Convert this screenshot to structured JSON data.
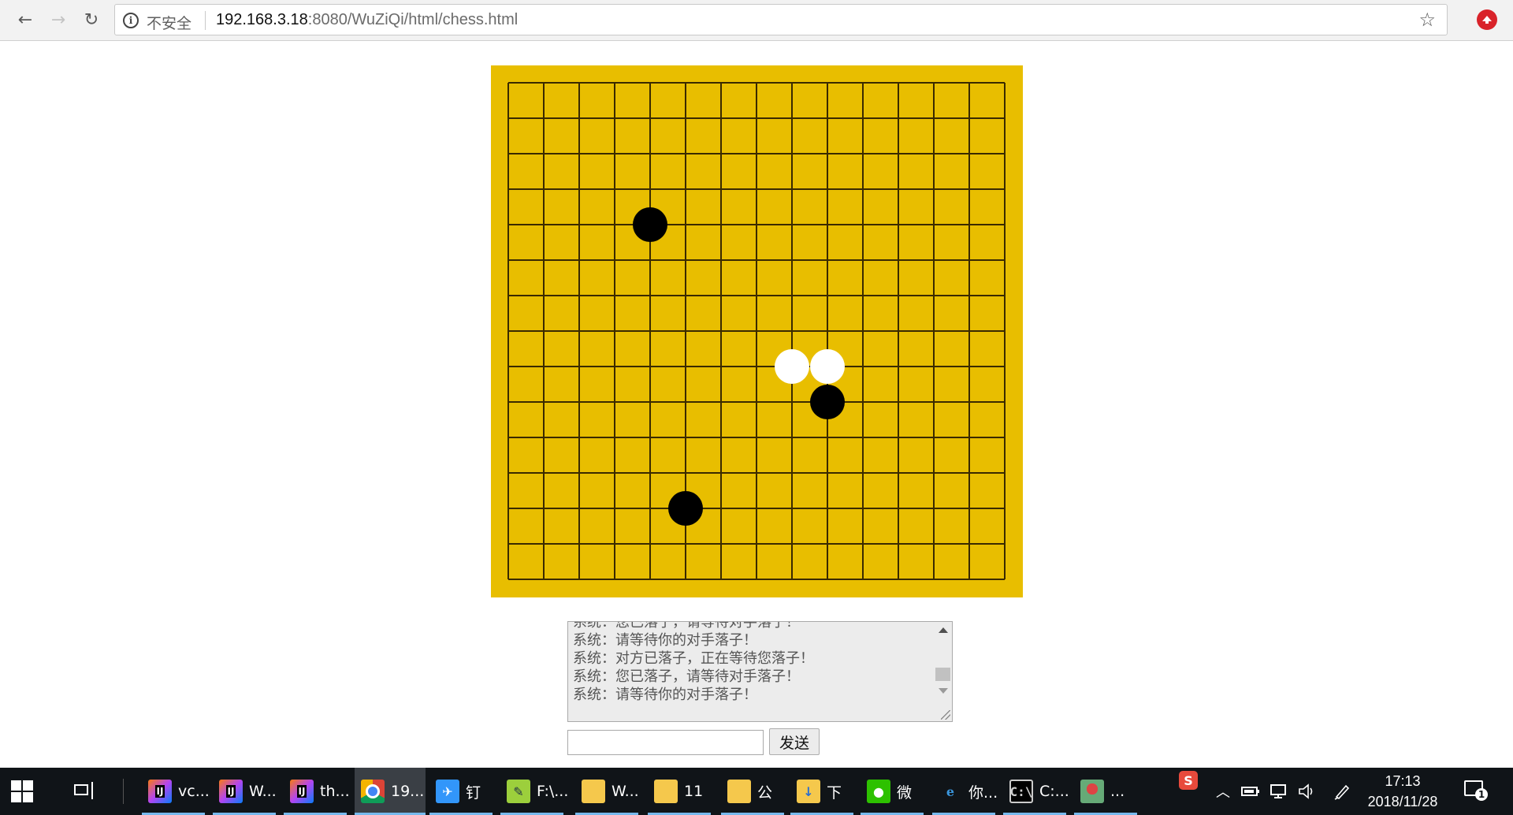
{
  "browser": {
    "back_icon": "←",
    "forward_icon": "→",
    "reload_icon": "↻",
    "info_icon": "i",
    "security_label": "不安全",
    "url_host": "192.168.3.18",
    "url_path": ":8080/WuZiQi/html/chess.html",
    "bookmark_icon": "☆"
  },
  "board": {
    "grid_size": 15,
    "line_color": "#3a2a00",
    "board_color": "#e8be00",
    "stones": [
      {
        "col": 4,
        "row": 4,
        "color": "black"
      },
      {
        "col": 8,
        "row": 8,
        "color": "white"
      },
      {
        "col": 9,
        "row": 8,
        "color": "white"
      },
      {
        "col": 9,
        "row": 9,
        "color": "black"
      },
      {
        "col": 5,
        "row": 12,
        "color": "black"
      }
    ]
  },
  "chat": {
    "lines": [
      "系统：您已落子，请等待对手落子！",
      "系统：请等待你的对手落子！",
      "系统：对方已落子，正在等待您落子！",
      "系统：您已落子，请等待对手落子！",
      "系统：请等待你的对手落子！"
    ],
    "input_value": "",
    "send_label": "发送"
  },
  "taskbar": {
    "apps": [
      {
        "name": "intellij-1",
        "label": "vc...",
        "icon": "IJ"
      },
      {
        "name": "intellij-2",
        "label": "W...",
        "icon": "IJ"
      },
      {
        "name": "intellij-3",
        "label": "th...",
        "icon": "IJ"
      },
      {
        "name": "chrome",
        "label": "19...",
        "icon": ""
      },
      {
        "name": "dingtalk",
        "label": "钉",
        "icon": "✈"
      },
      {
        "name": "notepad-plus",
        "label": "F:\\...",
        "icon": "✎"
      },
      {
        "name": "folder-1",
        "label": "W...",
        "icon": ""
      },
      {
        "name": "folder-2",
        "label": "11",
        "icon": ""
      },
      {
        "name": "folder-3",
        "label": "公",
        "icon": ""
      },
      {
        "name": "folder-downloads",
        "label": "下",
        "icon": "↓"
      },
      {
        "name": "wechat",
        "label": "微",
        "icon": "●"
      },
      {
        "name": "edge",
        "label": "你...",
        "icon": "e"
      },
      {
        "name": "cmd",
        "label": "C:...",
        "icon": "C:\\"
      },
      {
        "name": "avatar-app",
        "label": "...",
        "icon": ""
      }
    ],
    "tray": {
      "ime_label": "S",
      "time": "17:13",
      "date": "2018/11/28",
      "notification_count": "1"
    }
  }
}
